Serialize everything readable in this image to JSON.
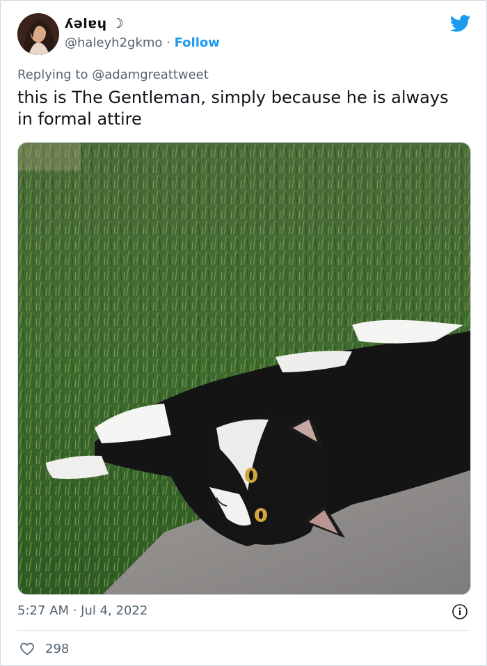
{
  "author": {
    "display_name": "ʎǝlɐɥ ☽",
    "handle": "@haleyh2gkmo",
    "separator": " · ",
    "follow_label": "Follow"
  },
  "reply": {
    "prefix": "Replying to ",
    "mention": "@adamgreattweet"
  },
  "tweet": {
    "text": "this is The Gentleman, simply because he is always in formal attire"
  },
  "meta": {
    "timestamp": "5:27 AM · Jul 4, 2022",
    "like_count": "298"
  },
  "icons": {
    "brand": "twitter-bird-icon",
    "info": "info-icon",
    "like": "heart-icon"
  },
  "colors": {
    "accent": "#1d9bf0",
    "secondary_text": "#536471",
    "divider": "#cfd9de"
  }
}
